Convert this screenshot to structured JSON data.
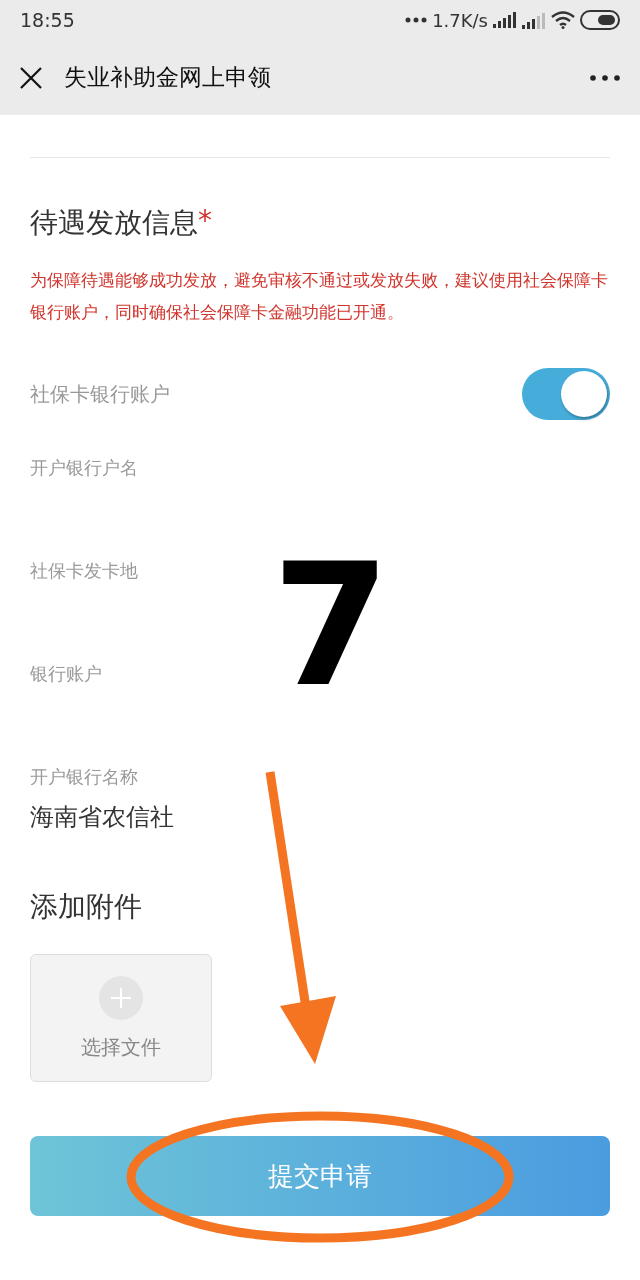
{
  "status_bar": {
    "time": "18:55",
    "network_speed": "1.7K/s"
  },
  "nav_bar": {
    "title": "失业补助金网上申领"
  },
  "section": {
    "title": "待遇发放信息",
    "required_mark": "*",
    "notice": "为保障待遇能够成功发放，避免审核不通过或发放失败，建议使用社会保障卡银行账户，同时确保社会保障卡金融功能已开通。"
  },
  "toggle": {
    "label": "社保卡银行账户",
    "on": true
  },
  "fields": [
    {
      "label": "开户银行户名"
    },
    {
      "label": "社保卡发卡地"
    },
    {
      "label": "银行账户"
    },
    {
      "label": "开户银行名称",
      "value": "海南省农信社"
    }
  ],
  "attachments": {
    "title": "添加附件",
    "upload_label": "选择文件"
  },
  "submit_button": {
    "label": "提交申请"
  },
  "annotation": {
    "step_number": "7"
  }
}
